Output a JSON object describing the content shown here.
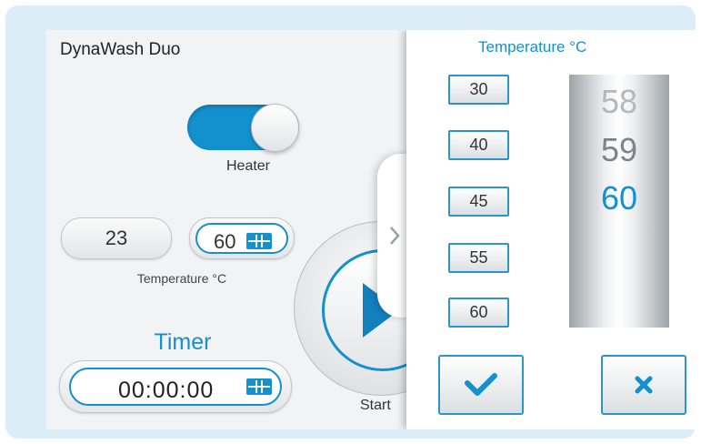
{
  "device": {
    "title": "DynaWash Duo"
  },
  "heater": {
    "label": "Heater",
    "state": "on"
  },
  "temperature": {
    "current": "23",
    "set": "60",
    "label": "Temperature °C"
  },
  "timer": {
    "label": "Timer",
    "value": "00:00:00"
  },
  "start": {
    "label": "Start"
  },
  "panel": {
    "title": "Temperature °C",
    "presets": [
      "30",
      "40",
      "45",
      "55",
      "60"
    ],
    "picker": {
      "above2": "58",
      "above1": "59",
      "selected": "60"
    }
  },
  "icons": {
    "keypad": "keypad-icon",
    "play": "play-icon",
    "check": "check-icon",
    "close": "close-icon",
    "chevron": "chevron-right-icon"
  },
  "colors": {
    "accent": "#1391cf",
    "frame": "#dcedf7"
  }
}
